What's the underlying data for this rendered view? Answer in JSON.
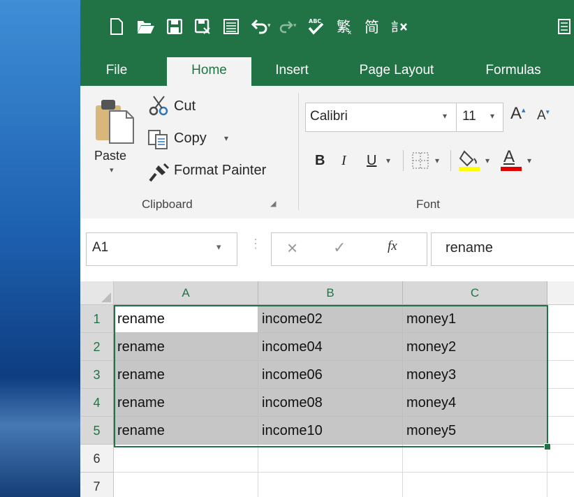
{
  "window": {
    "tabs": [
      {
        "label": "File"
      },
      {
        "label": "Home"
      },
      {
        "label": "Insert"
      },
      {
        "label": "Page Layout"
      },
      {
        "label": "Formulas"
      }
    ],
    "active_tab": "Home",
    "accent_color": "#217346"
  },
  "ribbon": {
    "clipboard": {
      "paste_label": "Paste",
      "cut_label": "Cut",
      "copy_label": "Copy",
      "format_painter_label": "Format Painter",
      "group_label": "Clipboard"
    },
    "font": {
      "font_name": "Calibri",
      "font_size": "11",
      "bold": "B",
      "italic": "I",
      "underline": "U",
      "font_color_glyph": "A",
      "grow_glyph": "A",
      "group_label": "Font"
    }
  },
  "formula_bar": {
    "name_box": "A1",
    "fx_label": "fx",
    "value": "rename"
  },
  "sheet": {
    "columns": [
      "A",
      "B",
      "C"
    ],
    "row_numbers": [
      "1",
      "2",
      "3",
      "4",
      "5",
      "6",
      "7"
    ],
    "rows": [
      [
        "rename",
        "income02",
        "money1"
      ],
      [
        "rename",
        "income04",
        "money2"
      ],
      [
        "rename",
        "income06",
        "money3"
      ],
      [
        "rename",
        "income08",
        "money4"
      ],
      [
        "rename",
        "income10",
        "money5"
      ]
    ],
    "active_cell": "A1",
    "selection": "A1:C5"
  }
}
